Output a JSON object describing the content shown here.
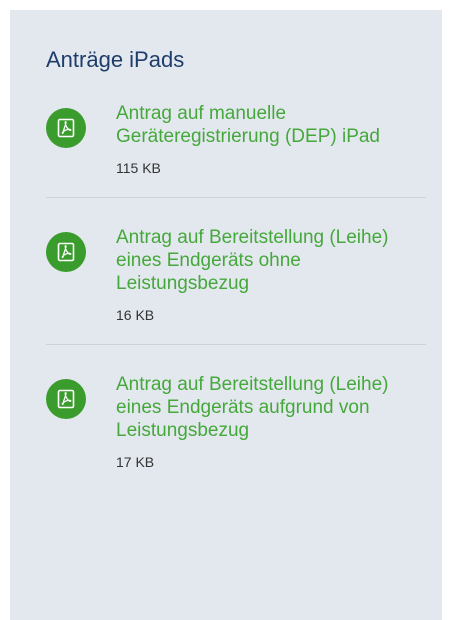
{
  "panel": {
    "title": "Anträge iPads",
    "icon": "pdf-file-icon",
    "colors": {
      "title": "#1f3d6b",
      "link": "#45a83a",
      "badge": "#3a9c2c",
      "panel_background": "#e3e8ef"
    },
    "documents": [
      {
        "title": "Antrag auf manuelle Geräteregistrierung (DEP) iPad",
        "size": "115 KB"
      },
      {
        "title": "Antrag auf Bereitstellung (Leihe) eines Endgeräts ohne Leistungsbezug",
        "size": "16 KB"
      },
      {
        "title": "Antrag auf Bereitstellung (Leihe) eines Endgeräts aufgrund von Leistungsbezug",
        "size": "17 KB"
      }
    ]
  }
}
